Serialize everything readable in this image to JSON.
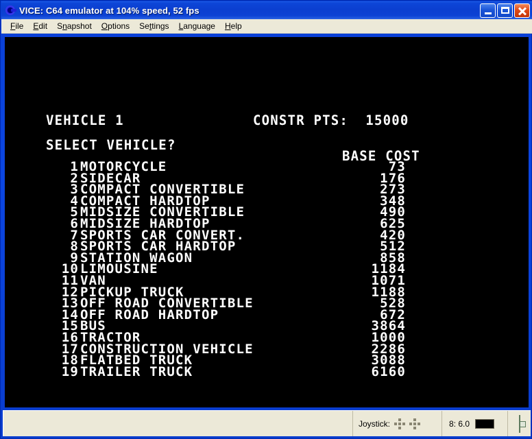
{
  "window": {
    "title": "VICE: C64 emulator at 104% speed, 52 fps",
    "app_icon": "vice-logo-icon",
    "minimize_label": "",
    "maximize_label": "",
    "close_label": "",
    "title_bar_color": "#0b3fd0",
    "frame_color": "#0a0ae0"
  },
  "menubar": {
    "items": [
      {
        "label": "File",
        "accel": "F"
      },
      {
        "label": "Edit",
        "accel": "E"
      },
      {
        "label": "Snapshot",
        "accel": "n"
      },
      {
        "label": "Options",
        "accel": "O"
      },
      {
        "label": "Settings",
        "accel": "t"
      },
      {
        "label": "Language",
        "accel": "L"
      },
      {
        "label": "Help",
        "accel": "H"
      }
    ]
  },
  "emulator_screen": {
    "background_color": "#000000",
    "text_color": "#ffffff",
    "header": {
      "vehicle_label": "VEHICLE 1",
      "constr_pts_label": "CONSTR PTS:",
      "constr_pts_value": "15000",
      "constr_pts_line": "CONSTR PTS:  15000",
      "prompt": "SELECT VEHICLE?",
      "cost_column_header": "BASE COST"
    },
    "vehicles": [
      {
        "num": "1",
        "name": "MOTORCYCLE",
        "cost": "73"
      },
      {
        "num": "2",
        "name": "SIDECAR",
        "cost": "176"
      },
      {
        "num": "3",
        "name": "COMPACT CONVERTIBLE",
        "cost": "273"
      },
      {
        "num": "4",
        "name": "COMPACT HARDTOP",
        "cost": "348"
      },
      {
        "num": "5",
        "name": "MIDSIZE CONVERTIBLE",
        "cost": "490"
      },
      {
        "num": "6",
        "name": "MIDSIZE HARDTOP",
        "cost": "625"
      },
      {
        "num": "7",
        "name": "SPORTS CAR CONVERT.",
        "cost": "420"
      },
      {
        "num": "8",
        "name": "SPORTS CAR HARDTOP",
        "cost": "512"
      },
      {
        "num": "9",
        "name": "STATION WAGON",
        "cost": "858"
      },
      {
        "num": "10",
        "name": "LIMOUSINE",
        "cost": "1184"
      },
      {
        "num": "11",
        "name": "VAN",
        "cost": "1071"
      },
      {
        "num": "12",
        "name": "PICKUP TRUCK",
        "cost": "1188"
      },
      {
        "num": "13",
        "name": "OFF ROAD CONVERTIBLE",
        "cost": "528"
      },
      {
        "num": "14",
        "name": "OFF ROAD HARDTOP",
        "cost": "672"
      },
      {
        "num": "15",
        "name": "BUS",
        "cost": "3864"
      },
      {
        "num": "16",
        "name": "TRACTOR",
        "cost": "1000"
      },
      {
        "num": "17",
        "name": "CONSTRUCTION VEHICLE",
        "cost": "2286"
      },
      {
        "num": "18",
        "name": "FLATBED TRUCK",
        "cost": "3088"
      },
      {
        "num": "19",
        "name": "TRAILER TRUCK",
        "cost": "6160"
      }
    ]
  },
  "statusbar": {
    "message": "",
    "joystick_label": "Joystick:",
    "drive_label": "8: 6.0",
    "drive_led_color": "#000000",
    "tape_icon": "tape-counter-icon"
  }
}
